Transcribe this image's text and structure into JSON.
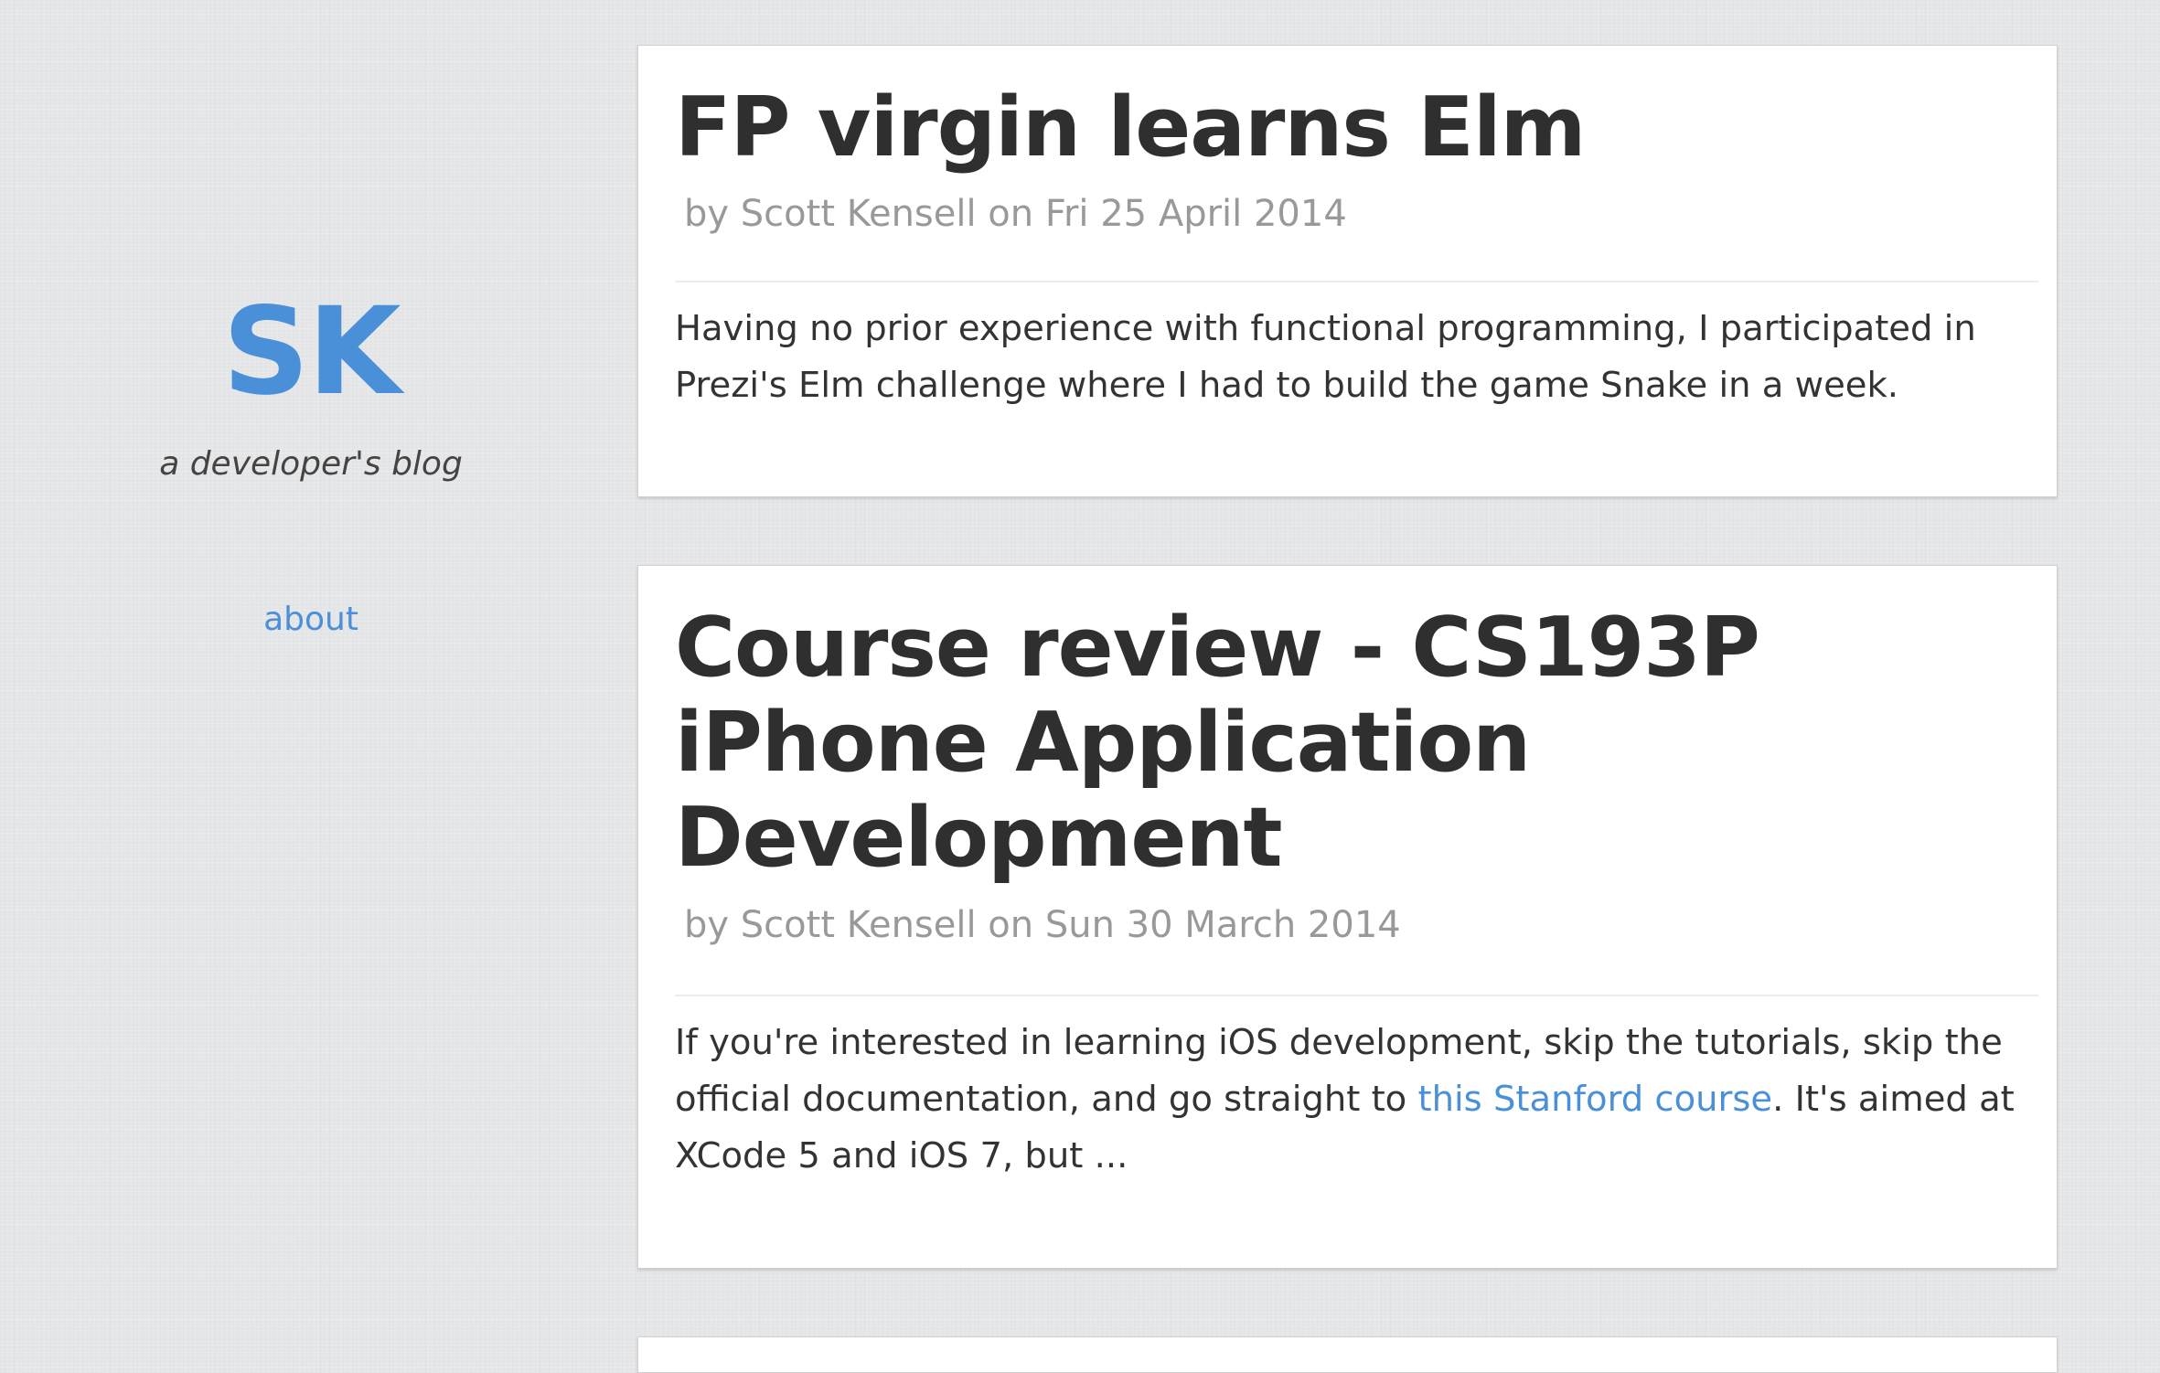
{
  "sidebar": {
    "logo": "SK",
    "tagline": "a developer's blog",
    "nav": {
      "about_label": "about"
    }
  },
  "colors": {
    "accent": "#4a90d9",
    "heading": "#2f2f2f",
    "meta": "#999999",
    "background": "#e5e6e8"
  },
  "posts": [
    {
      "title": "FP virgin learns Elm",
      "byline": "by Scott Kensell on Fri 25 April 2014",
      "excerpt": "Having no prior experience with functional programming, I participated in Prezi's Elm challenge where I had to build the game Snake in a week."
    },
    {
      "title": "Course review - CS193P iPhone Application Development",
      "byline": "by Scott Kensell on Sun 30 March 2014",
      "excerpt_before_link": "If you're interested in learning iOS development, skip the tutorials, skip the official documentation, and go straight to ",
      "excerpt_link": "this Stanford course",
      "excerpt_after_link": ". It's aimed at XCode 5 and iOS 7, but ..."
    }
  ]
}
